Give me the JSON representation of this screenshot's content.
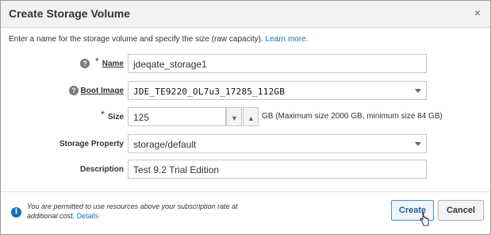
{
  "dialog": {
    "title": "Create Storage Volume",
    "close_glyph": "×",
    "intro_text": "Enter a name for the storage volume and specify the size (raw capacity).",
    "learn_more": "Learn more."
  },
  "fields": {
    "name": {
      "label": "Name",
      "required": "*",
      "value": "jdeqate_storage1",
      "help_icon": "question-icon"
    },
    "boot_image": {
      "label": "Boot Image",
      "value": "JDE_TE9220_OL7u3_17285_112GB",
      "help_icon": "question-icon"
    },
    "size": {
      "label": "Size",
      "required": "*",
      "value": "125",
      "hint": "GB (Maximum size 2000 GB, minimum size 84 GB)"
    },
    "storage_property": {
      "label": "Storage Property",
      "value": "storage/default"
    },
    "description": {
      "label": "Description",
      "value": "Test 9.2 Trial Edition"
    }
  },
  "footer": {
    "info_text": "You are permitted to use resources above your subscription rate at additional cost.",
    "details_link": "Details",
    "create_label": "Create",
    "cancel_label": "Cancel"
  },
  "colors": {
    "accent": "#1a6fb5",
    "title_bar": "#f2f2f2"
  }
}
